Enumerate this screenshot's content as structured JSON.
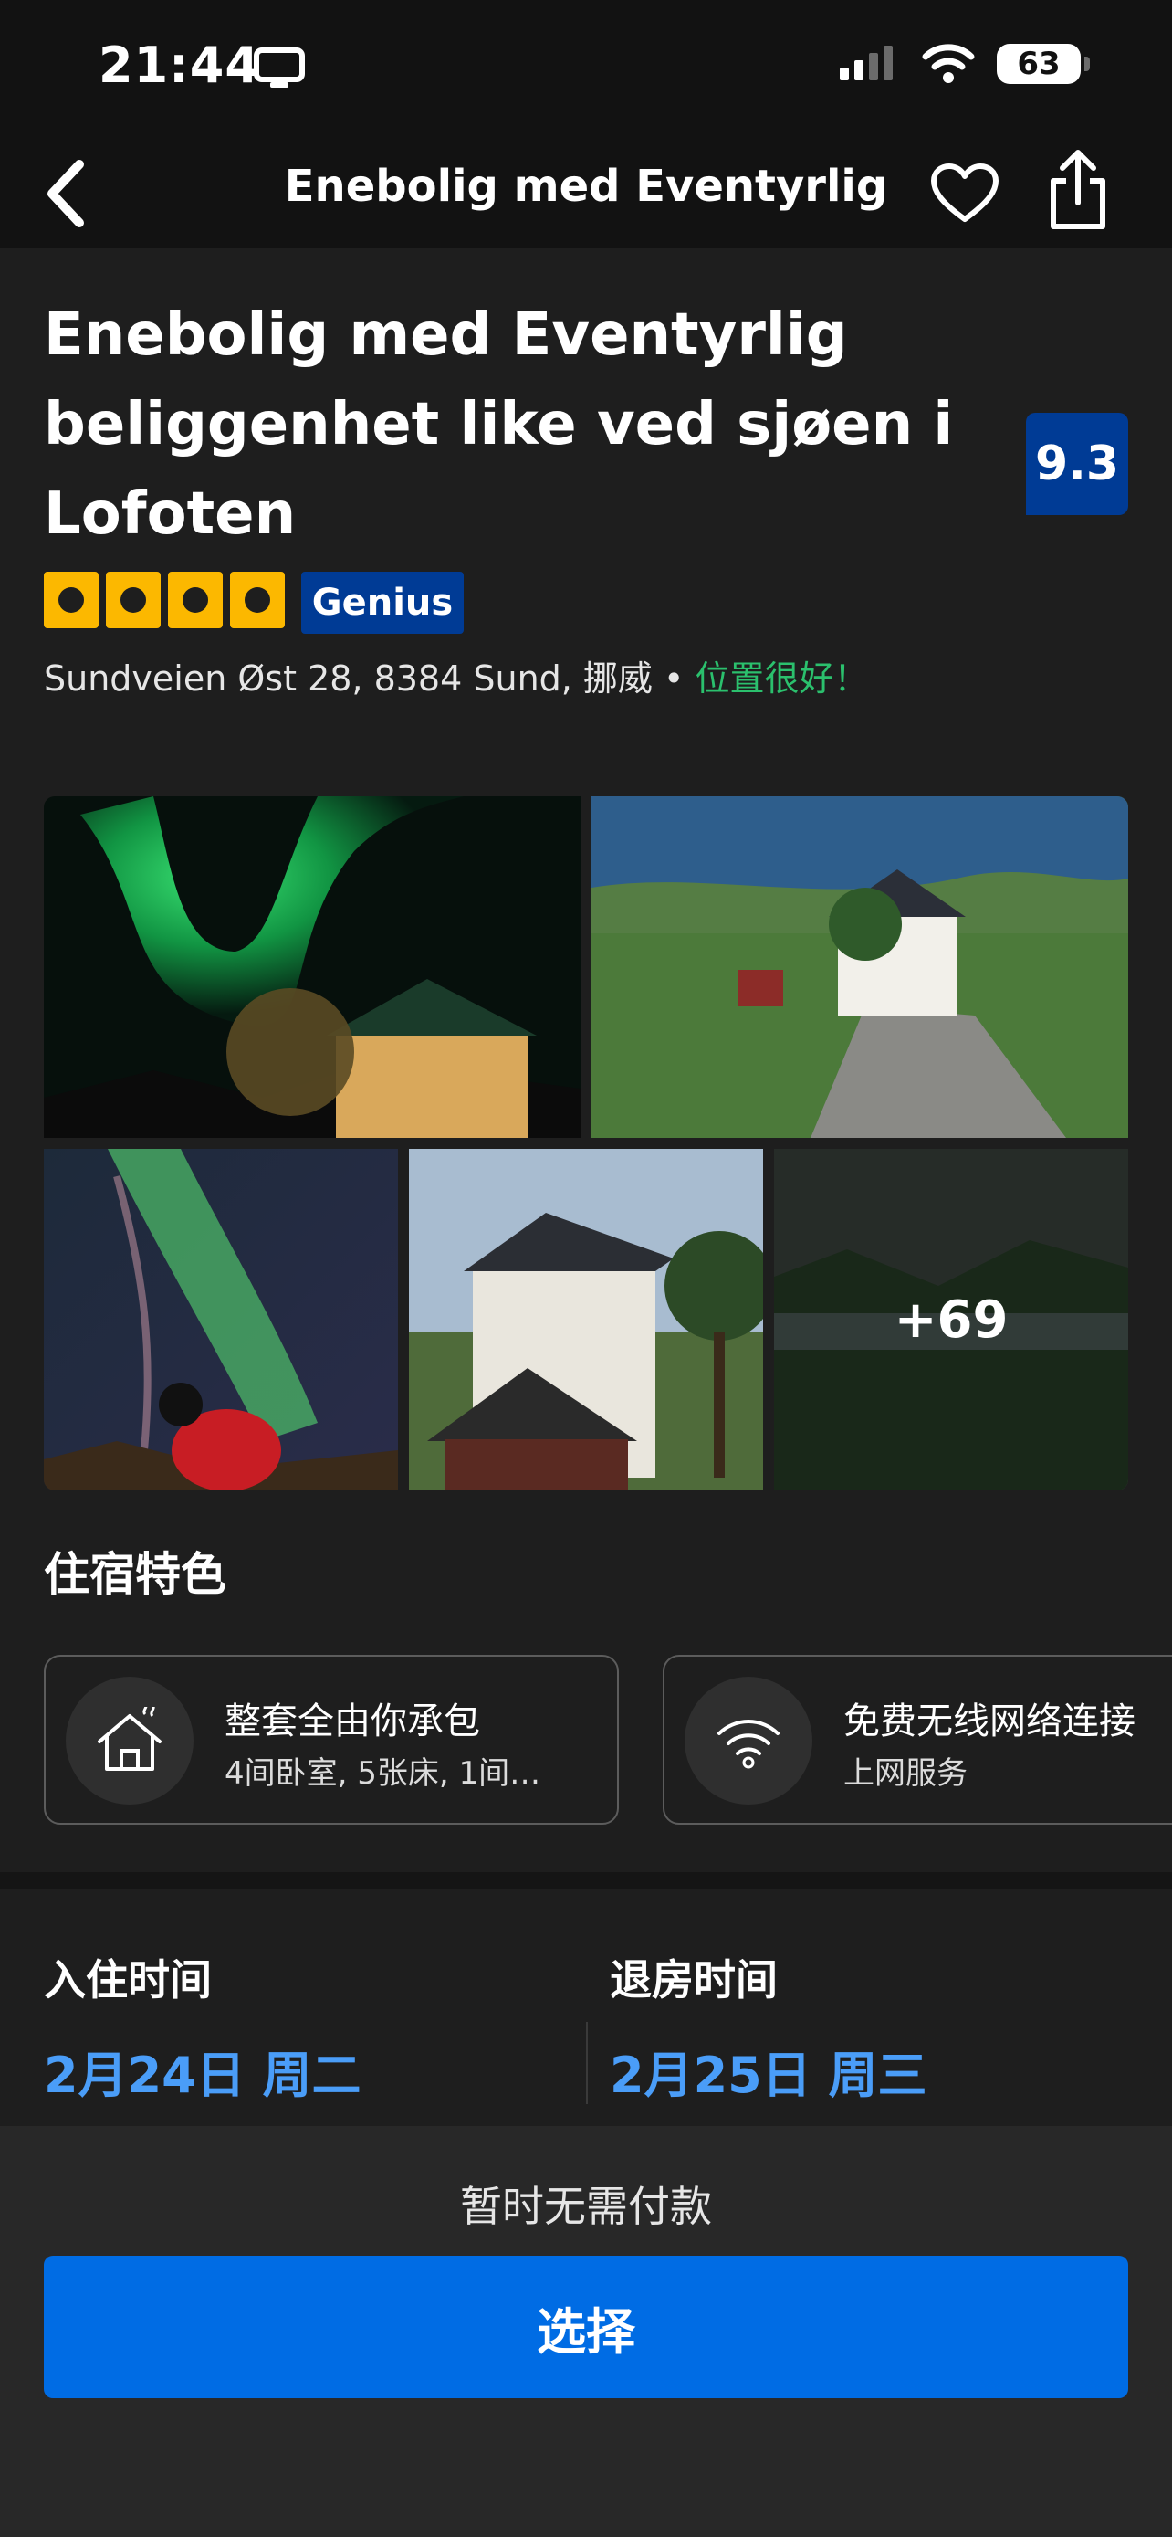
{
  "status_bar": {
    "time": "21:44",
    "battery": "63"
  },
  "nav": {
    "title": "Enebolig med Eventyrlig"
  },
  "hotel": {
    "title": "Enebolig med Eventyrlig beliggenhet like ved sjøen i Lofoten",
    "score": "9.3",
    "stars": 4,
    "genius": "Genius",
    "address": "Sundveien Øst 28, 8384 Sund, 挪威 • ",
    "location_note": "位置很好！"
  },
  "photos": {
    "more_count": "+69"
  },
  "features": {
    "title": "住宿特色",
    "items": [
      {
        "icon": "house-icon",
        "title": "整套全由你承包",
        "subtitle": "4间卧室, 5张床, 1间…"
      },
      {
        "icon": "wifi-icon",
        "title": "免费无线网络连接",
        "subtitle": "上网服务"
      }
    ]
  },
  "dates": {
    "checkin_label": "入住时间",
    "checkin_value": "2月24日 周二",
    "checkout_label": "退房时间",
    "checkout_value": "2月25日 周三"
  },
  "footer": {
    "no_payment": "暂时无需付款",
    "select_button": "选择"
  },
  "colors": {
    "accent": "#006ce4",
    "score_bg": "#003b95",
    "star": "#fcb800",
    "good": "#2bc06d",
    "date": "#4a9df8"
  }
}
